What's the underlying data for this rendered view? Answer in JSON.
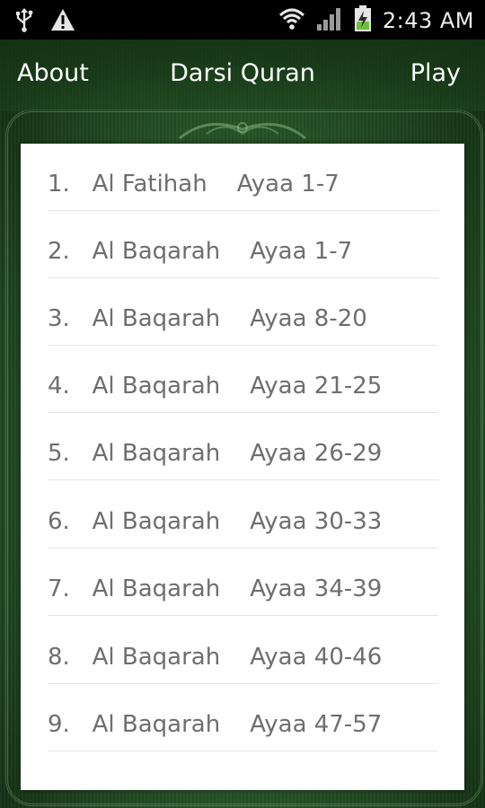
{
  "status_bar": {
    "time": "2:43 AM",
    "icons": [
      "usb-icon",
      "warning-icon",
      "wifi-icon",
      "signal-icon",
      "battery-charging-icon"
    ]
  },
  "header": {
    "about_label": "About",
    "title": "Darsi Quran",
    "play_label": "Play"
  },
  "lessons": [
    "1.   Al Fatihah    Ayaa 1-7",
    "2.   Al Baqarah    Ayaa 1-7",
    "3.   Al Baqarah    Ayaa 8-20",
    "4.   Al Baqarah    Ayaa 21-25",
    "5.   Al Baqarah    Ayaa 26-29",
    "6.   Al Baqarah    Ayaa 30-33",
    "7.   Al Baqarah    Ayaa 34-39",
    "8.   Al Baqarah    Ayaa 40-46",
    "9.   Al Baqarah    Ayaa 47-57"
  ],
  "colors": {
    "background_green": "#2c5e2b",
    "list_text": "#6e6e6e",
    "divider": "#e4e4e4"
  }
}
